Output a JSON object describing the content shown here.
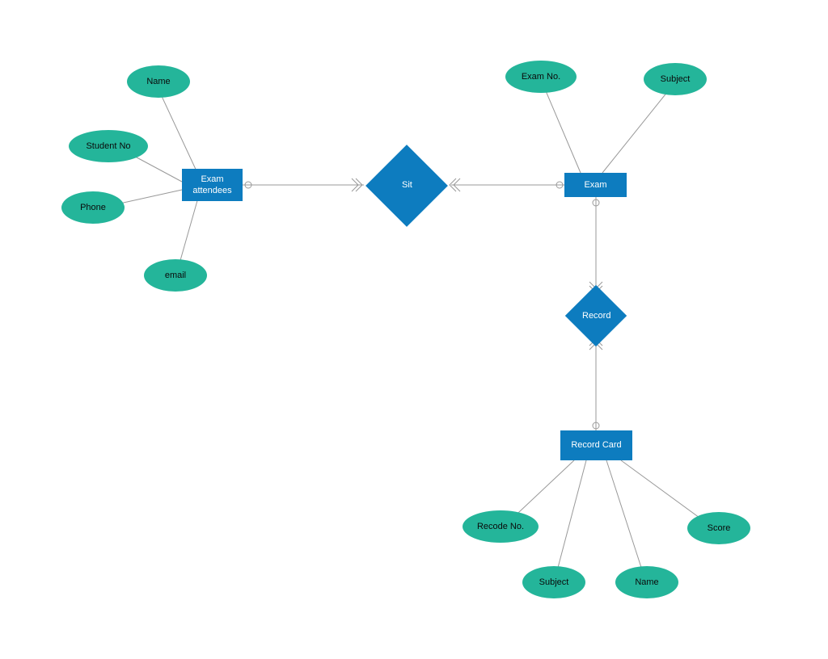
{
  "entities": {
    "exam_attendees": "Exam attendees",
    "exam": "Exam",
    "record_card": "Record Card"
  },
  "relationships": {
    "sit": "Sit",
    "record": "Record"
  },
  "attributes": {
    "name": "Name",
    "student_no": "Student No",
    "phone": "Phone",
    "email": "email",
    "exam_no": "Exam No.",
    "subject_top": "Subject",
    "recode_no": "Recode No.",
    "subject_bottom": "Subject",
    "name_bottom": "Name",
    "score": "Score"
  }
}
